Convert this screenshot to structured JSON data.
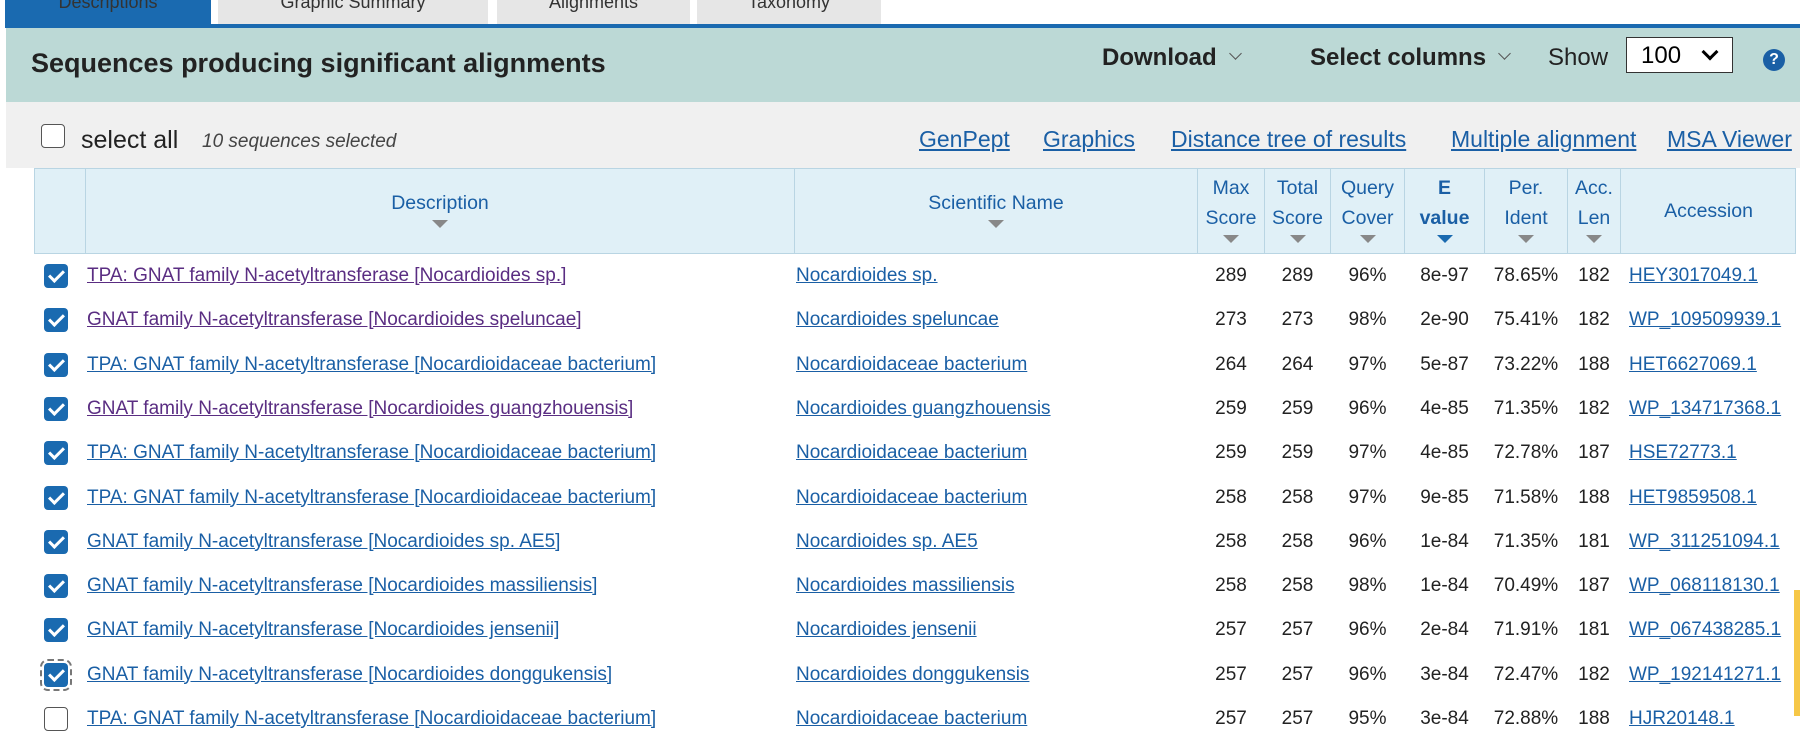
{
  "tabs": [
    {
      "label": "Descriptions",
      "active": true
    },
    {
      "label": "Graphic Summary",
      "active": false
    },
    {
      "label": "Alignments",
      "active": false
    },
    {
      "label": "Taxonomy",
      "active": false
    }
  ],
  "header": {
    "title": "Sequences producing significant alignments",
    "download_label": "Download",
    "select_columns_label": "Select columns",
    "show_label": "Show",
    "show_value": "100",
    "help_symbol": "?"
  },
  "toolbar": {
    "select_all_label": "select all",
    "selected_count": "10 sequences selected",
    "links": [
      "GenPept",
      "Graphics",
      "Distance tree of results",
      "Multiple alignment",
      "MSA Viewer"
    ]
  },
  "table": {
    "headers": {
      "description": "Description",
      "scientific_name": "Scientific Name",
      "max_score_1": "Max",
      "max_score_2": "Score",
      "total_score_1": "Total",
      "total_score_2": "Score",
      "query_cover_1": "Query",
      "query_cover_2": "Cover",
      "e_value_1": "E",
      "e_value_2": "value",
      "per_ident_1": "Per.",
      "per_ident_2": "Ident",
      "acc_len_1": "Acc.",
      "acc_len_2": "Len",
      "accession": "Accession"
    },
    "rows": [
      {
        "checked": true,
        "visited": true,
        "description": "TPA: GNAT family N-acetyltransferase [Nocardioides sp.]",
        "scientific_name": "Nocardioides sp.",
        "max_score": "289",
        "total_score": "289",
        "query_cover": "96%",
        "e_value": "8e-97",
        "per_ident": "78.65%",
        "acc_len": "182",
        "accession": "HEY3017049.1"
      },
      {
        "checked": true,
        "visited": true,
        "description": "GNAT family N-acetyltransferase [Nocardioides speluncae]",
        "scientific_name": "Nocardioides speluncae",
        "max_score": "273",
        "total_score": "273",
        "query_cover": "98%",
        "e_value": "2e-90",
        "per_ident": "75.41%",
        "acc_len": "182",
        "accession": "WP_109509939.1"
      },
      {
        "checked": true,
        "visited": false,
        "description": "TPA: GNAT family N-acetyltransferase [Nocardioidaceae bacterium]",
        "scientific_name": "Nocardioidaceae bacterium",
        "max_score": "264",
        "total_score": "264",
        "query_cover": "97%",
        "e_value": "5e-87",
        "per_ident": "73.22%",
        "acc_len": "188",
        "accession": "HET6627069.1"
      },
      {
        "checked": true,
        "visited": true,
        "description": "GNAT family N-acetyltransferase [Nocardioides guangzhouensis]",
        "scientific_name": "Nocardioides guangzhouensis",
        "max_score": "259",
        "total_score": "259",
        "query_cover": "96%",
        "e_value": "4e-85",
        "per_ident": "71.35%",
        "acc_len": "182",
        "accession": "WP_134717368.1"
      },
      {
        "checked": true,
        "visited": false,
        "description": "TPA: GNAT family N-acetyltransferase [Nocardioidaceae bacterium]",
        "scientific_name": "Nocardioidaceae bacterium",
        "max_score": "259",
        "total_score": "259",
        "query_cover": "97%",
        "e_value": "4e-85",
        "per_ident": "72.78%",
        "acc_len": "187",
        "accession": "HSE72773.1"
      },
      {
        "checked": true,
        "visited": false,
        "description": "TPA: GNAT family N-acetyltransferase [Nocardioidaceae bacterium]",
        "scientific_name": "Nocardioidaceae bacterium",
        "max_score": "258",
        "total_score": "258",
        "query_cover": "97%",
        "e_value": "9e-85",
        "per_ident": "71.58%",
        "acc_len": "188",
        "accession": "HET9859508.1"
      },
      {
        "checked": true,
        "visited": false,
        "description": "GNAT family N-acetyltransferase [Nocardioides sp. AE5]",
        "scientific_name": "Nocardioides sp. AE5",
        "max_score": "258",
        "total_score": "258",
        "query_cover": "96%",
        "e_value": "1e-84",
        "per_ident": "71.35%",
        "acc_len": "181",
        "accession": "WP_311251094.1"
      },
      {
        "checked": true,
        "visited": false,
        "description": "GNAT family N-acetyltransferase [Nocardioides massiliensis]",
        "scientific_name": "Nocardioides massiliensis",
        "max_score": "258",
        "total_score": "258",
        "query_cover": "98%",
        "e_value": "1e-84",
        "per_ident": "70.49%",
        "acc_len": "187",
        "accession": "WP_068118130.1"
      },
      {
        "checked": true,
        "visited": false,
        "description": "GNAT family N-acetyltransferase [Nocardioides jensenii]",
        "scientific_name": "Nocardioides jensenii",
        "max_score": "257",
        "total_score": "257",
        "query_cover": "96%",
        "e_value": "2e-84",
        "per_ident": "71.91%",
        "acc_len": "181",
        "accession": "WP_067438285.1"
      },
      {
        "checked": true,
        "visited": false,
        "focused": true,
        "description": "GNAT family N-acetyltransferase [Nocardioides donggukensis]",
        "scientific_name": "Nocardioides donggukensis",
        "max_score": "257",
        "total_score": "257",
        "query_cover": "96%",
        "e_value": "3e-84",
        "per_ident": "72.47%",
        "acc_len": "182",
        "accession": "WP_192141271.1"
      },
      {
        "checked": false,
        "visited": false,
        "description": "TPA: GNAT family N-acetyltransferase [Nocardioidaceae bacterium]",
        "scientific_name": "Nocardioidaceae bacterium",
        "max_score": "257",
        "total_score": "257",
        "query_cover": "95%",
        "e_value": "3e-84",
        "per_ident": "72.88%",
        "acc_len": "188",
        "accession": "HJR20148.1"
      }
    ]
  },
  "colors": {
    "accent": "#1a6ab0",
    "header_band": "#bcd9d6",
    "link": "#1a5fa5",
    "visited_link": "#5a2d82"
  }
}
